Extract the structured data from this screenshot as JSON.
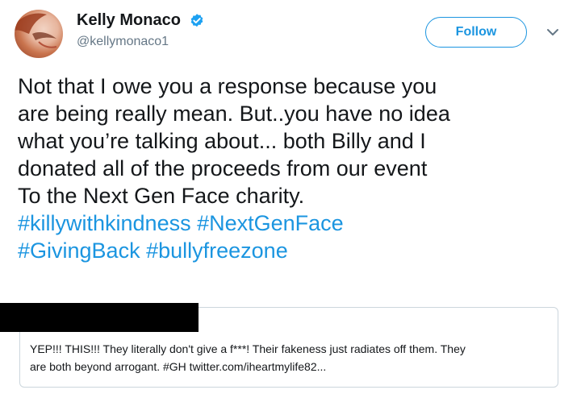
{
  "user": {
    "display_name": "Kelly Monaco",
    "handle": "@kellymonaco1",
    "verified_icon": "verified-badge-icon",
    "follow_label": "Follow",
    "menu_icon": "chevron-down-icon"
  },
  "tweet": {
    "lines": [
      "Not that I owe you a response because you",
      "are being really mean. But..you have no idea",
      "what you’re talking about... both Billy and I",
      "donated all of the proceeds from our event",
      "To the Next Gen Face charity."
    ],
    "hashtags_line1": [
      "#killywithkindness",
      "#NextGenFace"
    ],
    "hashtags_line2": [
      "#GivingBack",
      "#bullyfreezone"
    ]
  },
  "quote": {
    "lines": [
      "YEP!!! THIS!!! They literally don't give a f***! Their fakeness just radiates off them. They",
      "are both beyond arrogant. #GH twitter.com/iheartmylife82..."
    ]
  },
  "colors": {
    "link": "#1b95e0",
    "text": "#14171a",
    "muted": "#657786",
    "border": "#ccd6dd"
  }
}
